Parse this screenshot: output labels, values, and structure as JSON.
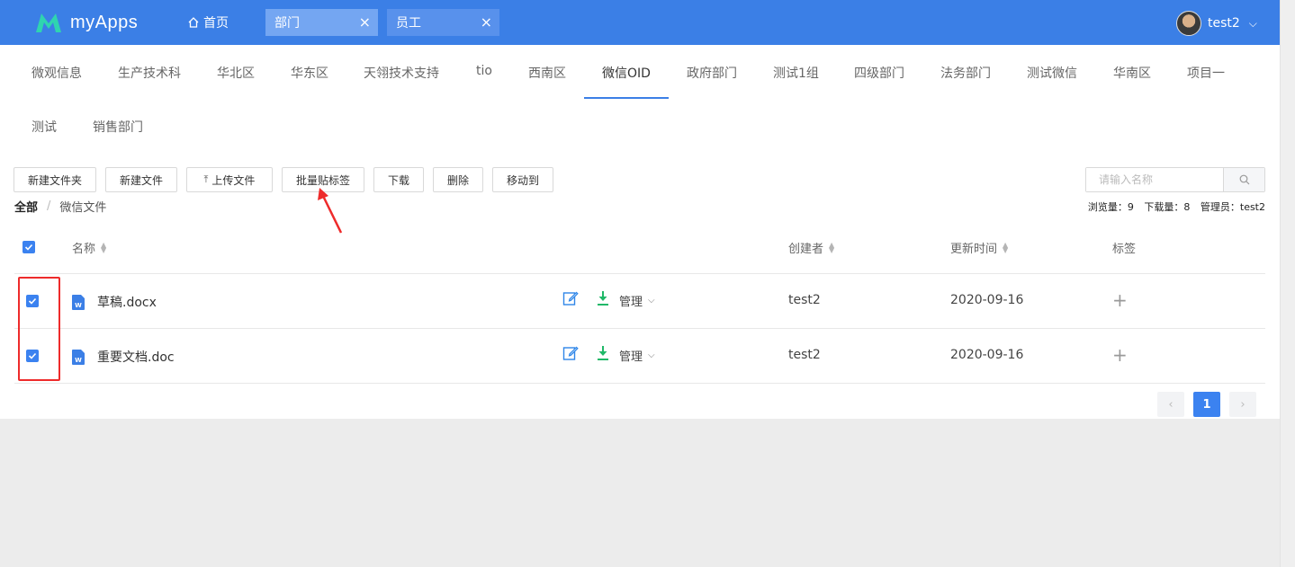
{
  "app": {
    "name": "myApps",
    "brand_color": "#3b7fe6"
  },
  "topnav": {
    "home_label": "首页",
    "tabs": [
      {
        "label": "部门",
        "active": true
      },
      {
        "label": "员工",
        "active": false
      }
    ],
    "close_glyph": "×",
    "user": {
      "name": "test2"
    }
  },
  "dept_tabs": {
    "items": [
      "微观信息",
      "生产技术科",
      "华北区",
      "华东区",
      "天翎技术支持",
      "tio",
      "西南区",
      "微信OID",
      "政府部门",
      "测试1组",
      "四级部门",
      "法务部门",
      "测试微信",
      "华南区",
      "项目一",
      "测试",
      "销售部门"
    ],
    "active": "微信OID"
  },
  "toolbar": {
    "new_folder": "新建文件夹",
    "new_file": "新建文件",
    "upload": "上传文件",
    "batch_tag": "批量贴标签",
    "download": "下载",
    "delete": "删除",
    "move_to": "移动到"
  },
  "search": {
    "placeholder": "请输入名称"
  },
  "breadcrumb": {
    "root": "全部",
    "separator": "/",
    "current": "微信文件"
  },
  "stats": {
    "views": "浏览量：9",
    "downloads": "下载量：8",
    "admin": "管理员：test2"
  },
  "table": {
    "headers": {
      "name": "名称",
      "creator": "创建者",
      "updated": "更新时间",
      "tags": "标签"
    },
    "rows": [
      {
        "name": "草稿.docx",
        "manage": "管理",
        "creator": "test2",
        "updated": "2020-09-16",
        "checked": true
      },
      {
        "name": "重要文档.doc",
        "manage": "管理",
        "creator": "test2",
        "updated": "2020-09-16",
        "checked": true
      }
    ],
    "icons": {
      "file": "word-file-icon",
      "edit": "edit-icon",
      "download": "download-icon",
      "add_tag": "plus-icon"
    }
  },
  "pagination": {
    "current": "1",
    "prev": "‹",
    "next": "›"
  },
  "annotation_color": "#ee2b2b"
}
